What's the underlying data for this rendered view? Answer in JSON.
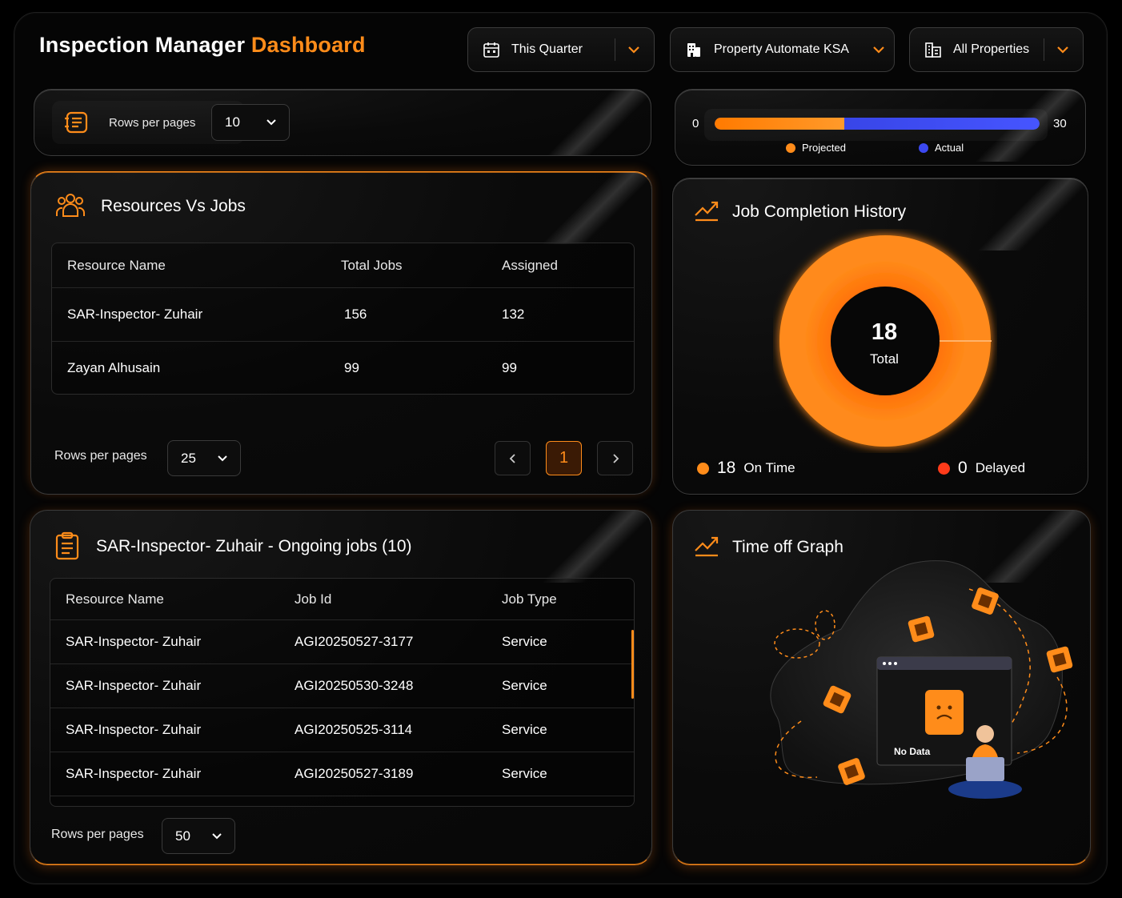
{
  "header": {
    "title_main": "Inspection Manager",
    "title_accent": "Dashboard",
    "filters": [
      {
        "label": "This Quarter",
        "icon": "calendar-icon"
      },
      {
        "label": "Property Automate KSA",
        "icon": "building-icon"
      },
      {
        "label": "All Properties",
        "icon": "buildings-icon"
      }
    ]
  },
  "top_rows": {
    "icon": "list-icon",
    "label": "Rows per pages",
    "value": "10"
  },
  "progress": {
    "min": "0",
    "max": "30",
    "projected_value": 12,
    "actual_value": 30,
    "legend_projected": "Projected",
    "legend_actual": "Actual",
    "color_projected": "#ff8c1a",
    "color_actual": "#3b48f0"
  },
  "resources_panel": {
    "title": "Resources Vs Jobs",
    "icon": "users-icon",
    "columns": [
      "Resource Name",
      "Total Jobs",
      "Assigned"
    ],
    "rows": [
      [
        "SAR-Inspector- Zuhair",
        "156",
        "132"
      ],
      [
        "Zayan Alhusain",
        "99",
        "99"
      ]
    ],
    "rows_per_page_label": "Rows per pages",
    "rows_per_page_value": "25",
    "current_page": "1"
  },
  "completion_panel": {
    "title": "Job Completion History",
    "icon": "trend-chart-icon",
    "total_value": "18",
    "total_label": "Total",
    "on_time_value": "18",
    "on_time_label": "On Time",
    "delayed_value": "0",
    "delayed_label": "Delayed",
    "color_on_time": "#ff8c1a",
    "color_delayed": "#ff3b1a"
  },
  "ongoing_panel": {
    "title": "SAR-Inspector- Zuhair - Ongoing jobs (10)",
    "icon": "clipboard-icon",
    "columns": [
      "Resource Name",
      "Job Id",
      "Job Type"
    ],
    "rows": [
      [
        "SAR-Inspector- Zuhair",
        "AGI20250527-3177",
        "Service"
      ],
      [
        "SAR-Inspector- Zuhair",
        "AGI20250530-3248",
        "Service"
      ],
      [
        "SAR-Inspector- Zuhair",
        "AGI20250525-3114",
        "Service"
      ],
      [
        "SAR-Inspector- Zuhair",
        "AGI20250527-3189",
        "Service"
      ]
    ],
    "rows_per_page_label": "Rows per pages",
    "rows_per_page_value": "50"
  },
  "timeoff_panel": {
    "title": "Time off Graph",
    "icon": "trend-chart-icon",
    "empty_text": "No Data"
  }
}
